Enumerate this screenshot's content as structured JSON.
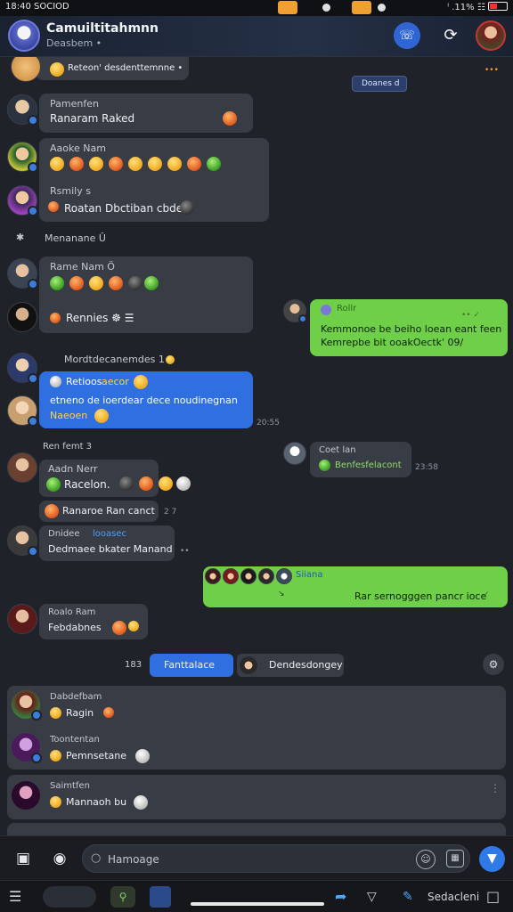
{
  "status": {
    "time": "18:40 SOCIOD",
    "right": "ᴵ .11% ☷"
  },
  "header": {
    "title": "Camuiltitahmnn",
    "subtitle": "Deasbem •",
    "call_icon": "phone-icon",
    "sync_icon": "refresh-icon"
  },
  "messages": {
    "m0": {
      "text": "Reteon' desdenttemnne •"
    },
    "tag": {
      "text": "Doanes d"
    },
    "m1": {
      "name": "Pamenfen",
      "text": "Ranaram Raked"
    },
    "m2": {
      "name": "Aaoke Nam"
    },
    "m3": {
      "name": "Rsmily s",
      "text": "Roatan Dbctiban cbdebi"
    },
    "sys1": {
      "text": "Menanane Û"
    },
    "m4": {
      "name": "Rame Nam Ö"
    },
    "m5": {
      "text": "Rennies ☸ ☰"
    },
    "out1": {
      "name": "Rollr",
      "text1": "Kemmonoe be beiho loean eant feen",
      "text2": "Kemrepbe bit ooakOectk' 09/"
    },
    "sys2": {
      "text": "Mordtdecanemdes  1 ►"
    },
    "m6": {
      "line1": "Retioos",
      "line1b": "aecor",
      "line2": "etneno de ioerdear dece noudinegnan",
      "line3": "Naeoen",
      "time": "20:55"
    },
    "m7": {
      "name": "Ren femt 3"
    },
    "out2": {
      "name": "Coet lan",
      "text": "Benfesfelacont",
      "time": "23:58"
    },
    "m8": {
      "name": "Aadn Nerr",
      "text": "Racelon."
    },
    "m9": {
      "text": "Ranaroe Ran canct",
      "time": "2 7"
    },
    "m10": {
      "name": "Dnidee",
      "name_link": "looasec",
      "text": "Dedmaee bkater Manand"
    },
    "out3": {
      "link": "Siiana",
      "text": "Rar sernogggen pancr ioce"
    },
    "m11": {
      "name": "Roalo Ram",
      "text": "Febdabnes"
    },
    "pill_row": {
      "count": "183",
      "blue": "Fanttalace",
      "dark": "Dendesdongey"
    },
    "card1": {
      "name": "Dabdefbam",
      "text": "Ragin"
    },
    "card1b": {
      "name": "Toontentan",
      "text": "Pemnsetane"
    },
    "card2": {
      "name": "Saimtfen",
      "text": "Mannaoh bu"
    }
  },
  "composer": {
    "placeholder": "Hamoage",
    "camera_icon": "camera-icon",
    "photo_icon": "photo-icon",
    "mic_icon": "mic-icon"
  },
  "navbar": {
    "label": "Sedacleni"
  }
}
